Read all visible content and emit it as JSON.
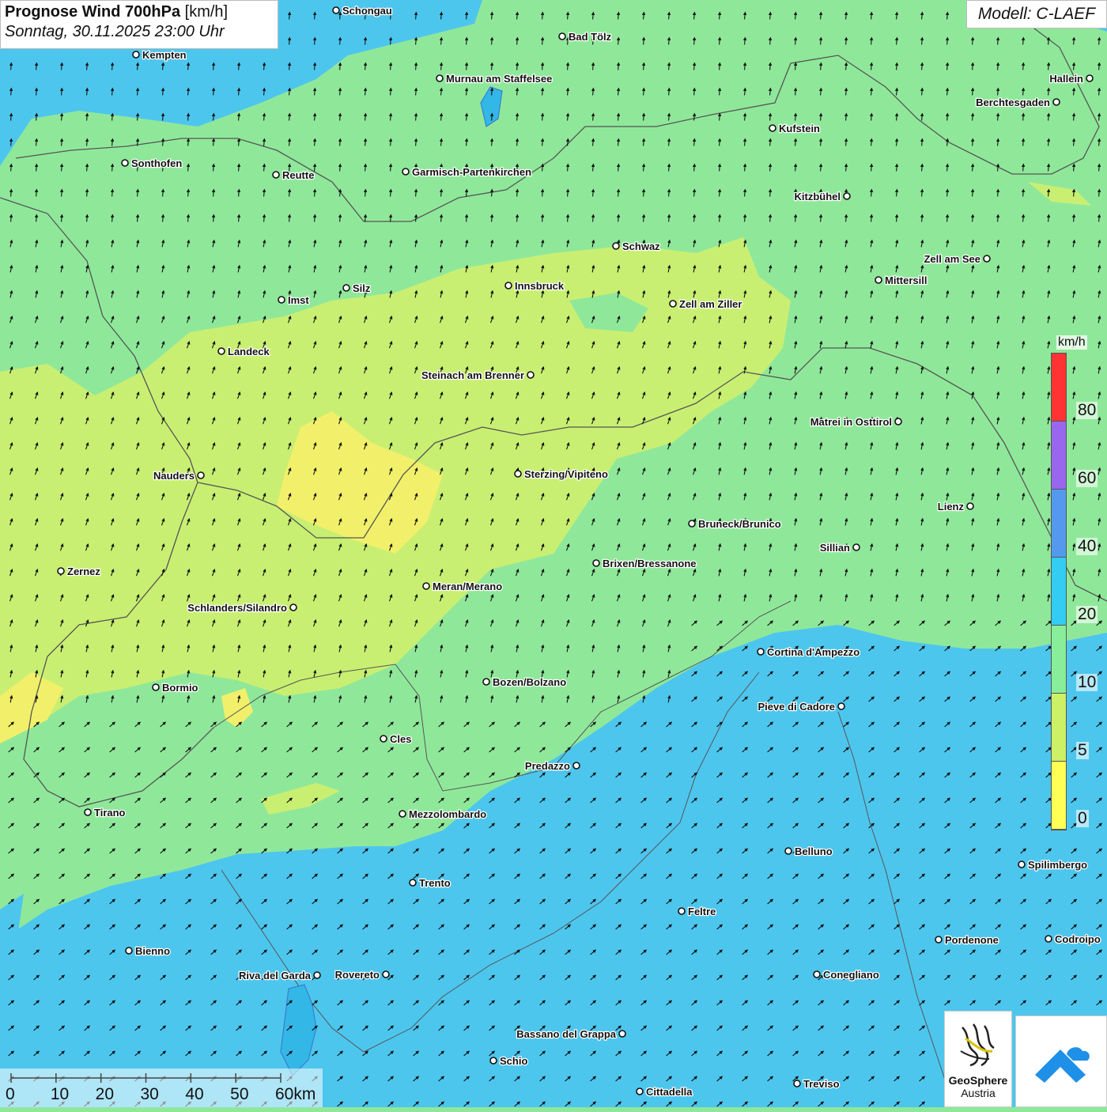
{
  "title": {
    "main": "Prognose Wind 700hPa",
    "unit": "[km/h]",
    "datetime": "Sonntag, 30.11.2025 23:00 Uhr"
  },
  "model": "Modell: C-LAEF",
  "legend": {
    "unit": "km/h",
    "ticks": [
      "80",
      "60",
      "40",
      "20",
      "10",
      "5",
      "0"
    ],
    "colors": [
      "#ff3333",
      "#9966ee",
      "#5599ee",
      "#33ccf2",
      "#88ee99",
      "#ccf066",
      "#ffff55"
    ]
  },
  "scale": {
    "labels": [
      "0",
      "10",
      "20",
      "30",
      "40",
      "50",
      "60km"
    ]
  },
  "logos": {
    "geosphere_name": "GeoSphere",
    "geosphere_sub": "Austria"
  },
  "cities": [
    {
      "name": "Schongau"
    },
    {
      "name": "Bad Tölz"
    },
    {
      "name": "Kempten"
    },
    {
      "name": "Murnau am Staffelsee"
    },
    {
      "name": "Hallein"
    },
    {
      "name": "Berchtesgaden"
    },
    {
      "name": "Kufstein"
    },
    {
      "name": "Sonthofen"
    },
    {
      "name": "Reutte"
    },
    {
      "name": "Garmisch-Partenkirchen"
    },
    {
      "name": "Kitzbühel"
    },
    {
      "name": "Schwaz"
    },
    {
      "name": "Zell am See"
    },
    {
      "name": "Mittersill"
    },
    {
      "name": "Imst"
    },
    {
      "name": "Silz"
    },
    {
      "name": "Innsbruck"
    },
    {
      "name": "Zell am Ziller"
    },
    {
      "name": "Landeck"
    },
    {
      "name": "Steinach am Brenner"
    },
    {
      "name": "Matrei in Osttirol"
    },
    {
      "name": "Nauders"
    },
    {
      "name": "Sterzing/Vipiteno"
    },
    {
      "name": "Lienz"
    },
    {
      "name": "Bruneck/Brunico"
    },
    {
      "name": "Sillian"
    },
    {
      "name": "Zernez"
    },
    {
      "name": "Brixen/Bressanone"
    },
    {
      "name": "Meran/Merano"
    },
    {
      "name": "Schlanders/Silandro"
    },
    {
      "name": "Cortina d'Ampezzo"
    },
    {
      "name": "Bozen/Bolzano"
    },
    {
      "name": "Bormio"
    },
    {
      "name": "Pieve di Cadore"
    },
    {
      "name": "Cles"
    },
    {
      "name": "Predazzo"
    },
    {
      "name": "Tirano"
    },
    {
      "name": "Mezzolombardo"
    },
    {
      "name": "Belluno"
    },
    {
      "name": "Spilimbergo"
    },
    {
      "name": "Trento"
    },
    {
      "name": "Feltre"
    },
    {
      "name": "Pordenone"
    },
    {
      "name": "Codroipo"
    },
    {
      "name": "Bienno"
    },
    {
      "name": "Riva del Garda"
    },
    {
      "name": "Rovereto"
    },
    {
      "name": "Conegliano"
    },
    {
      "name": "Bassano del Grappa"
    },
    {
      "name": "Schio"
    },
    {
      "name": "Treviso"
    },
    {
      "name": "Cittadella"
    }
  ]
}
